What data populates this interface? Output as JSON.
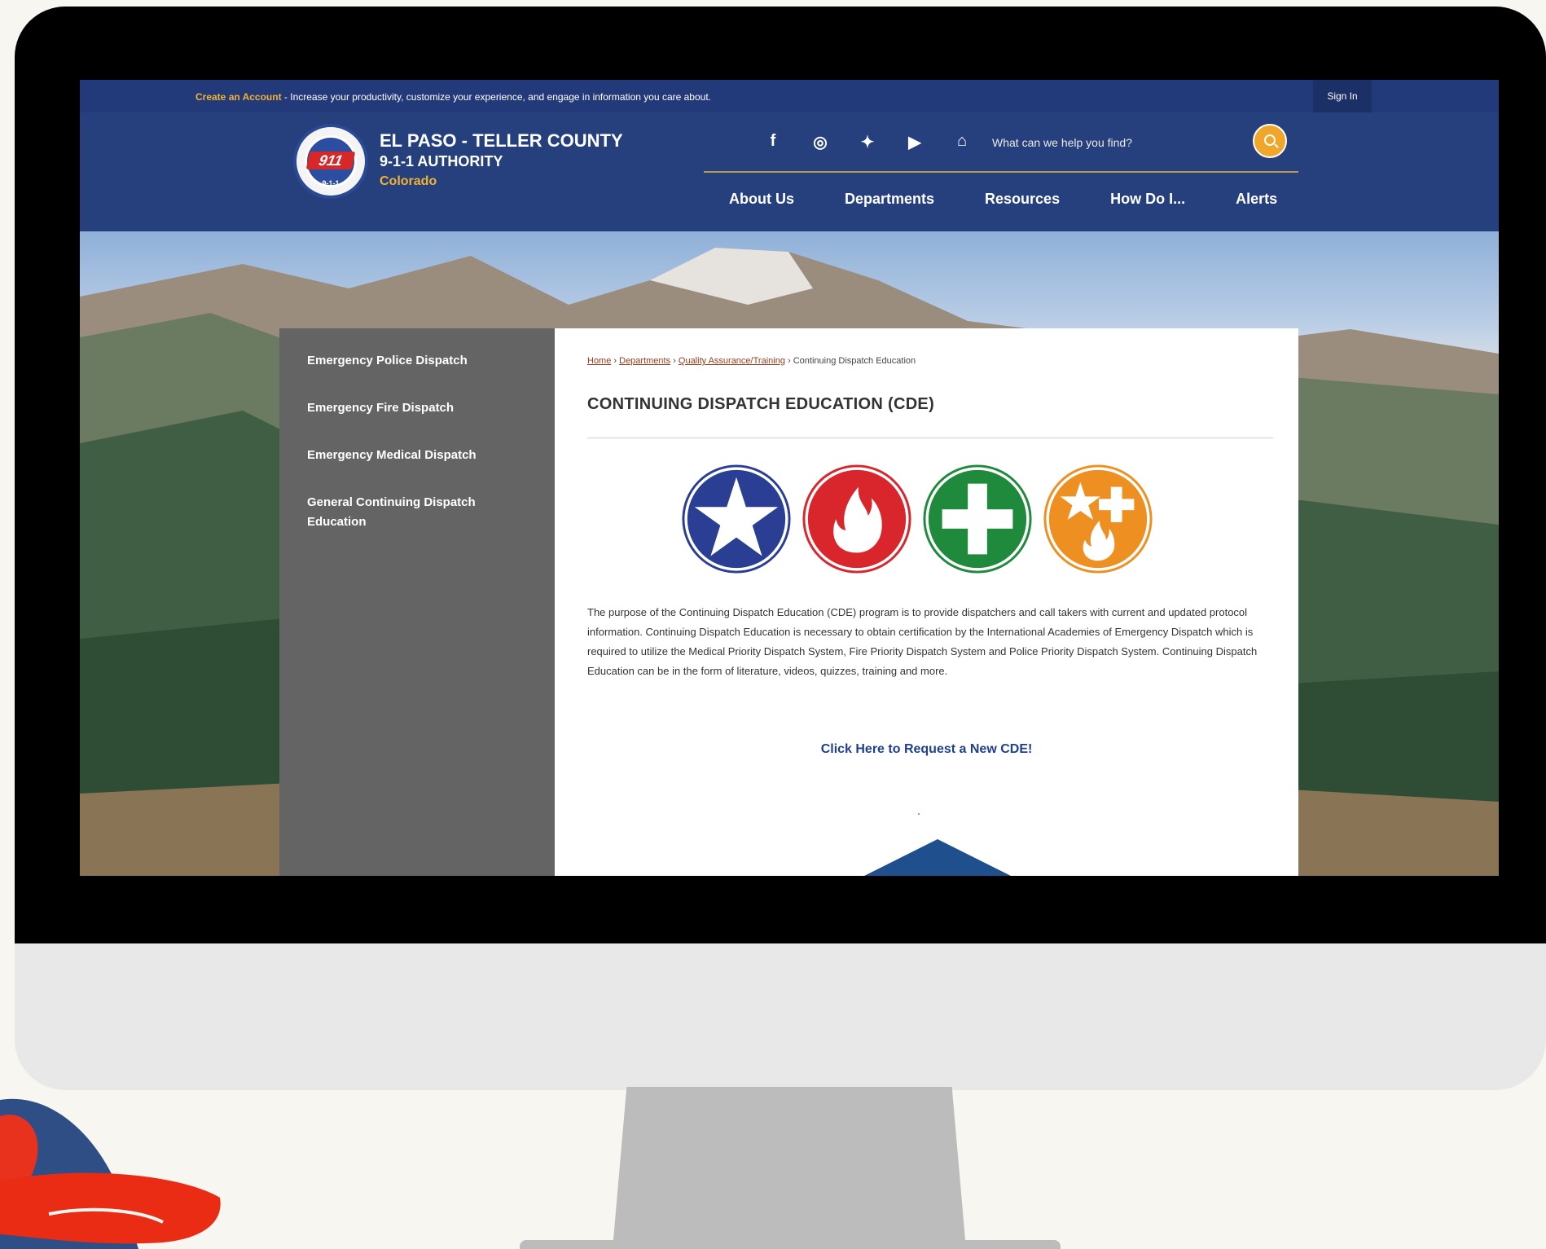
{
  "topbar": {
    "create_account": "Create an Account",
    "promo_text": " - Increase your productivity, customize your experience, and engage in information you care about.",
    "sign_in": "Sign In"
  },
  "header": {
    "org_name": "EL PASO - TELLER COUNTY",
    "org_sub": "9-1-1 AUTHORITY",
    "org_state": "Colorado",
    "seal_text": "911",
    "seal_bottom": "9-1-1",
    "social_icons": [
      "facebook-icon",
      "instagram-icon",
      "twitter-icon",
      "youtube-icon",
      "home-icon"
    ],
    "social_glyphs": [
      "f",
      "◎",
      "✦",
      "▶",
      "⌂"
    ],
    "search_placeholder": "What can we help you find?"
  },
  "nav": {
    "items": [
      "About Us",
      "Departments",
      "Resources",
      "How Do I...",
      "Alerts"
    ]
  },
  "sidebar": {
    "items": [
      "Emergency Police Dispatch",
      "Emergency Fire Dispatch",
      "Emergency Medical Dispatch",
      "General Continuing Dispatch Education"
    ]
  },
  "breadcrumb": {
    "home": "Home",
    "departments": "Departments",
    "qa_training": "Quality Assurance/Training",
    "current": "Continuing Dispatch Education",
    "separator": " › "
  },
  "content": {
    "title": "CONTINUING DISPATCH EDUCATION (CDE)",
    "description": "The purpose of the Continuing Dispatch Education (CDE) program is to provide dispatchers and call takers with current and updated protocol information.  Continuing Dispatch Education is necessary to obtain certification by the International Academies of Emergency Dispatch which is required to utilize the Medical Priority Dispatch System, Fire Priority Dispatch System and Police Priority Dispatch System.  Continuing Dispatch Education can be in the form of literature, videos, quizzes, training and more.",
    "cta": "Click Here to Request a New CDE!"
  },
  "colors": {
    "navy": "#26407e",
    "topbar": "#233a7a",
    "accent": "#f2b233",
    "police_blue": "#2a3f93",
    "fire_red": "#d8262c",
    "medical_green": "#1f8a3b",
    "general_orange": "#ee8f22",
    "sidebar_gray": "#646464"
  }
}
